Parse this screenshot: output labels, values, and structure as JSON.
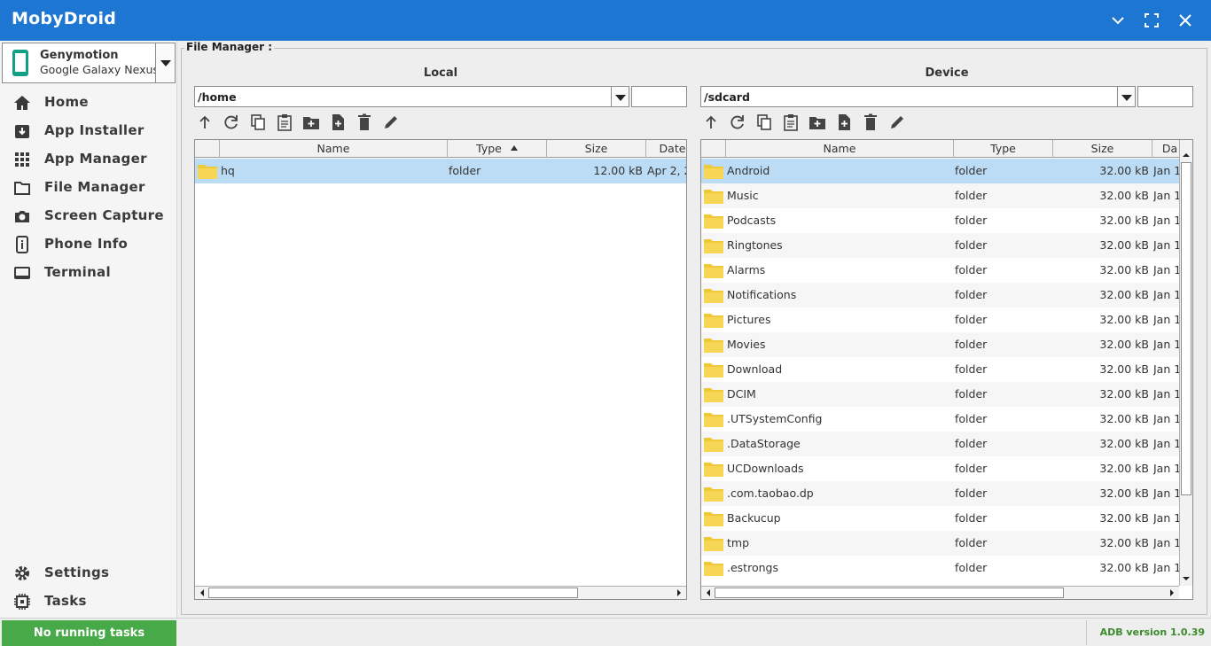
{
  "app": {
    "title": "MobyDroid"
  },
  "window_controls": [
    "minimize-icon",
    "maximize-icon",
    "close-icon"
  ],
  "device": {
    "name": "Genymotion",
    "model": "Google Galaxy Nexus"
  },
  "sidebar": {
    "items": [
      {
        "label": "Home",
        "icon": "home-icon"
      },
      {
        "label": "App Installer",
        "icon": "app-installer-icon"
      },
      {
        "label": "App Manager",
        "icon": "grid-icon"
      },
      {
        "label": "File Manager",
        "icon": "folder-icon"
      },
      {
        "label": "Screen Capture",
        "icon": "camera-icon"
      },
      {
        "label": "Phone Info",
        "icon": "info-icon"
      },
      {
        "label": "Terminal",
        "icon": "terminal-icon"
      }
    ],
    "bottom": [
      {
        "label": "Settings",
        "icon": "gear-icon"
      },
      {
        "label": "Tasks",
        "icon": "chip-icon"
      }
    ]
  },
  "file_manager": {
    "legend": "File Manager :",
    "local": {
      "title": "Local",
      "path": "/home",
      "columns": [
        "Name",
        "Type",
        "Size",
        "Date"
      ],
      "sort_column": "Type",
      "rows": [
        {
          "name": "hq",
          "type": "folder",
          "size": "12.00 kB",
          "date": "Apr 2, 2"
        }
      ]
    },
    "device": {
      "title": "Device",
      "path": "/sdcard",
      "columns": [
        "Name",
        "Type",
        "Size",
        "Da"
      ],
      "rows": [
        {
          "name": "Android",
          "type": "folder",
          "size": "32.00 kB",
          "date": "Jan 1"
        },
        {
          "name": "Music",
          "type": "folder",
          "size": "32.00 kB",
          "date": "Jan 1"
        },
        {
          "name": "Podcasts",
          "type": "folder",
          "size": "32.00 kB",
          "date": "Jan 1"
        },
        {
          "name": "Ringtones",
          "type": "folder",
          "size": "32.00 kB",
          "date": "Jan 1"
        },
        {
          "name": "Alarms",
          "type": "folder",
          "size": "32.00 kB",
          "date": "Jan 1"
        },
        {
          "name": "Notifications",
          "type": "folder",
          "size": "32.00 kB",
          "date": "Jan 1"
        },
        {
          "name": "Pictures",
          "type": "folder",
          "size": "32.00 kB",
          "date": "Jan 1"
        },
        {
          "name": "Movies",
          "type": "folder",
          "size": "32.00 kB",
          "date": "Jan 1"
        },
        {
          "name": "Download",
          "type": "folder",
          "size": "32.00 kB",
          "date": "Jan 1"
        },
        {
          "name": "DCIM",
          "type": "folder",
          "size": "32.00 kB",
          "date": "Jan 1"
        },
        {
          "name": ".UTSystemConfig",
          "type": "folder",
          "size": "32.00 kB",
          "date": "Jan 1"
        },
        {
          "name": ".DataStorage",
          "type": "folder",
          "size": "32.00 kB",
          "date": "Jan 1"
        },
        {
          "name": "UCDownloads",
          "type": "folder",
          "size": "32.00 kB",
          "date": "Jan 1"
        },
        {
          "name": ".com.taobao.dp",
          "type": "folder",
          "size": "32.00 kB",
          "date": "Jan 1"
        },
        {
          "name": "Backucup",
          "type": "folder",
          "size": "32.00 kB",
          "date": "Jan 1"
        },
        {
          "name": "tmp",
          "type": "folder",
          "size": "32.00 kB",
          "date": "Jan 1"
        },
        {
          "name": ".estrongs",
          "type": "folder",
          "size": "32.00 kB",
          "date": "Jan 1"
        }
      ]
    },
    "toolbar_icons": [
      "up-arrow-icon",
      "refresh-icon",
      "copy-icon",
      "paste-icon",
      "new-folder-icon",
      "new-file-icon",
      "delete-icon",
      "rename-icon"
    ]
  },
  "status": {
    "tasks": "No running tasks",
    "adb_version": "ADB version 1.0.39",
    "tasks_color": "#48a948",
    "accent": "#1c76d2"
  }
}
